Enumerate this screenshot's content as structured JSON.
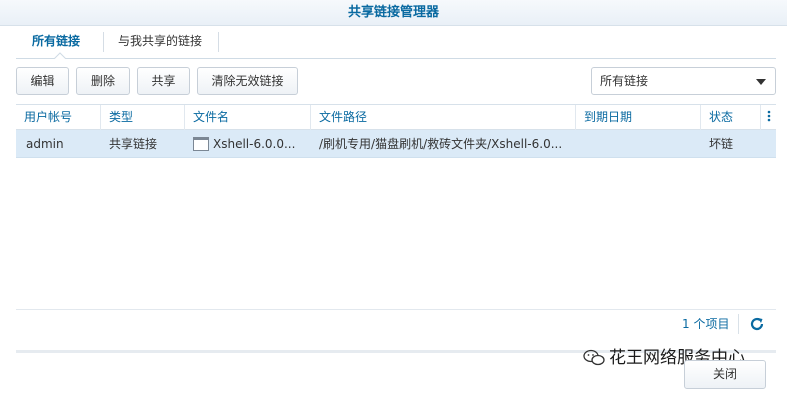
{
  "window": {
    "title": "共享链接管理器"
  },
  "tabs": [
    {
      "label": "所有链接"
    },
    {
      "label": "与我共享的链接"
    }
  ],
  "toolbar": {
    "edit_label": "编辑",
    "delete_label": "删除",
    "share_label": "共享",
    "clear_invalid_label": "清除无效链接",
    "filter_selected": "所有链接"
  },
  "table": {
    "columns": [
      "用户帐号",
      "类型",
      "文件名",
      "文件路径",
      "到期日期",
      "状态"
    ],
    "rows": [
      {
        "user": "admin",
        "type": "共享链接",
        "filename": "Xshell-6.0.0...",
        "path": "/刷机专用/猫盘刷机/救砖文件夹/Xshell-6.0...",
        "expiry": "",
        "status": "坏链"
      }
    ]
  },
  "pager": {
    "count_text": "1 个项目"
  },
  "watermark": {
    "text": "花王网络服务中心"
  },
  "footer": {
    "close_label": "关闭"
  },
  "colors": {
    "accent": "#0a6aa1",
    "selected_row": "#dbeaf7"
  },
  "icons": {
    "file": "file-icon",
    "refresh": "refresh-icon",
    "column_menu": "column-menu-icon",
    "dropdown": "chevron-down-icon"
  }
}
